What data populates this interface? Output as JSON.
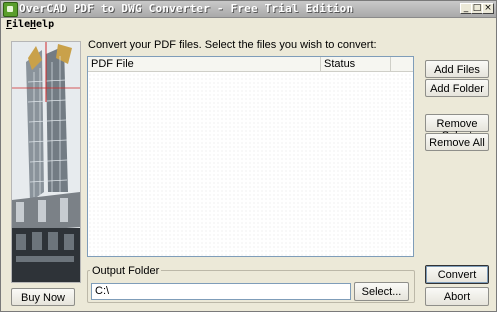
{
  "window": {
    "title": "OverCAD PDF to DWG Converter - Free Trial Edition",
    "controls": {
      "minimize": "_",
      "maximize": "□",
      "close": "×"
    }
  },
  "menu": {
    "file": {
      "mnemonic": "F",
      "rest": "ile"
    },
    "help": {
      "mnemonic": "H",
      "rest": "elp"
    }
  },
  "main": {
    "instruction": "Convert your PDF files. Select the files you wish to convert:",
    "columns": [
      "PDF File",
      "Status"
    ]
  },
  "buttons": {
    "add_files": "Add Files",
    "add_folder": "Add Folder",
    "remove_select": "Remove Select",
    "remove_all": "Remove All",
    "buy_now": "Buy Now",
    "select": "Select...",
    "convert": "Convert",
    "abort": "Abort"
  },
  "output": {
    "group_label": "Output Folder",
    "path": "C:\\"
  },
  "icons": {
    "app": "app-icon",
    "side": "building-image"
  }
}
